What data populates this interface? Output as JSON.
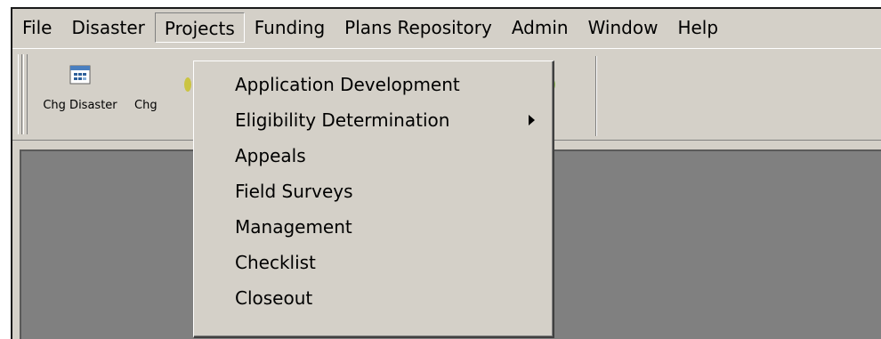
{
  "menubar": {
    "items": [
      {
        "label": "File"
      },
      {
        "label": "Disaster"
      },
      {
        "label": "Projects"
      },
      {
        "label": "Funding"
      },
      {
        "label": "Plans Repository"
      },
      {
        "label": "Admin"
      },
      {
        "label": "Window"
      },
      {
        "label": "Help"
      }
    ],
    "open_item": "Projects"
  },
  "toolbar": {
    "buttons": [
      {
        "label": "Chg Disaster",
        "icon": "calendar-icon"
      },
      {
        "label": "Chg",
        "icon": "toolbar-icon"
      }
    ]
  },
  "projects_menu": {
    "items": [
      {
        "label": "Application Development",
        "has_submenu": false
      },
      {
        "label": "Eligibility Determination",
        "has_submenu": true
      },
      {
        "label": "Appeals",
        "has_submenu": false
      },
      {
        "label": "Field Surveys",
        "has_submenu": false
      },
      {
        "label": "Management",
        "has_submenu": false
      },
      {
        "label": "Checklist",
        "has_submenu": false
      },
      {
        "label": "Closeout",
        "has_submenu": false
      }
    ]
  },
  "colors": {
    "chrome": "#d4d0c8",
    "workspace": "#808080",
    "border_dark": "#404040"
  }
}
